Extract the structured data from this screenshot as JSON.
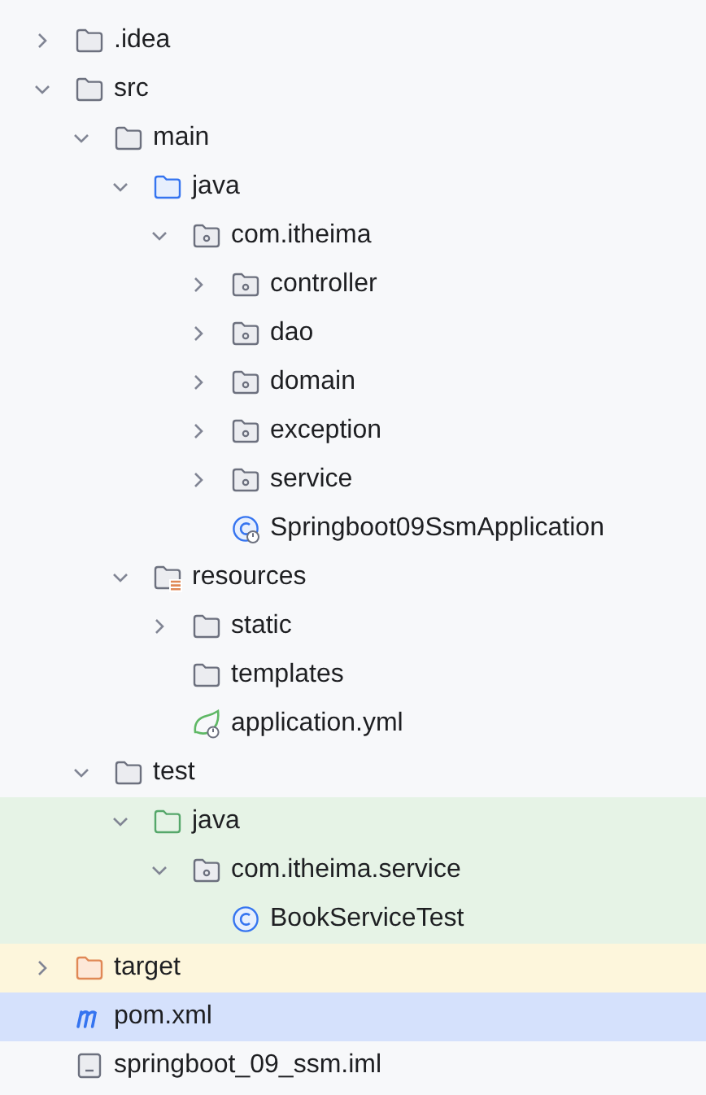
{
  "tree": [
    {
      "name": ".idea",
      "kind": "folder",
      "expanded": false,
      "selected": false
    },
    {
      "name": "src",
      "kind": "folder",
      "expanded": true,
      "selected": false,
      "children": [
        {
          "name": "main",
          "kind": "folder",
          "expanded": true,
          "selected": false,
          "children": [
            {
              "name": "java",
              "kind": "source-folder",
              "expanded": true,
              "selected": false,
              "children": [
                {
                  "name": "com.itheima",
                  "kind": "package",
                  "expanded": true,
                  "selected": false,
                  "children": [
                    {
                      "name": "controller",
                      "kind": "package",
                      "expanded": false,
                      "selected": false
                    },
                    {
                      "name": "dao",
                      "kind": "package",
                      "expanded": false,
                      "selected": false
                    },
                    {
                      "name": "domain",
                      "kind": "package",
                      "expanded": false,
                      "selected": false
                    },
                    {
                      "name": "exception",
                      "kind": "package",
                      "expanded": false,
                      "selected": false
                    },
                    {
                      "name": "service",
                      "kind": "package",
                      "expanded": false,
                      "selected": false
                    },
                    {
                      "name": "Springboot09SsmApplication",
                      "kind": "spring-class",
                      "selected": false
                    }
                  ]
                }
              ]
            },
            {
              "name": "resources",
              "kind": "resources-folder",
              "expanded": true,
              "selected": false,
              "children": [
                {
                  "name": "static",
                  "kind": "folder",
                  "expanded": false,
                  "selected": false
                },
                {
                  "name": "templates",
                  "kind": "folder",
                  "selected": false
                },
                {
                  "name": "application.yml",
                  "kind": "spring-config",
                  "selected": false
                }
              ]
            }
          ]
        },
        {
          "name": "test",
          "kind": "folder",
          "expanded": true,
          "selected": false,
          "children": [
            {
              "name": "java",
              "kind": "test-folder",
              "expanded": true,
              "selected": false,
              "test_source": true,
              "children": [
                {
                  "name": "com.itheima.service",
                  "kind": "package",
                  "expanded": true,
                  "selected": false,
                  "test_source": true,
                  "children": [
                    {
                      "name": "BookServiceTest",
                      "kind": "class",
                      "selected": false,
                      "test_source": true
                    }
                  ]
                }
              ]
            }
          ]
        }
      ]
    },
    {
      "name": "target",
      "kind": "excluded-folder",
      "expanded": false,
      "selected": false,
      "excluded": true
    },
    {
      "name": "pom.xml",
      "kind": "maven",
      "selected": true
    },
    {
      "name": "springboot_09_ssm.iml",
      "kind": "module-file",
      "selected": false
    }
  ]
}
